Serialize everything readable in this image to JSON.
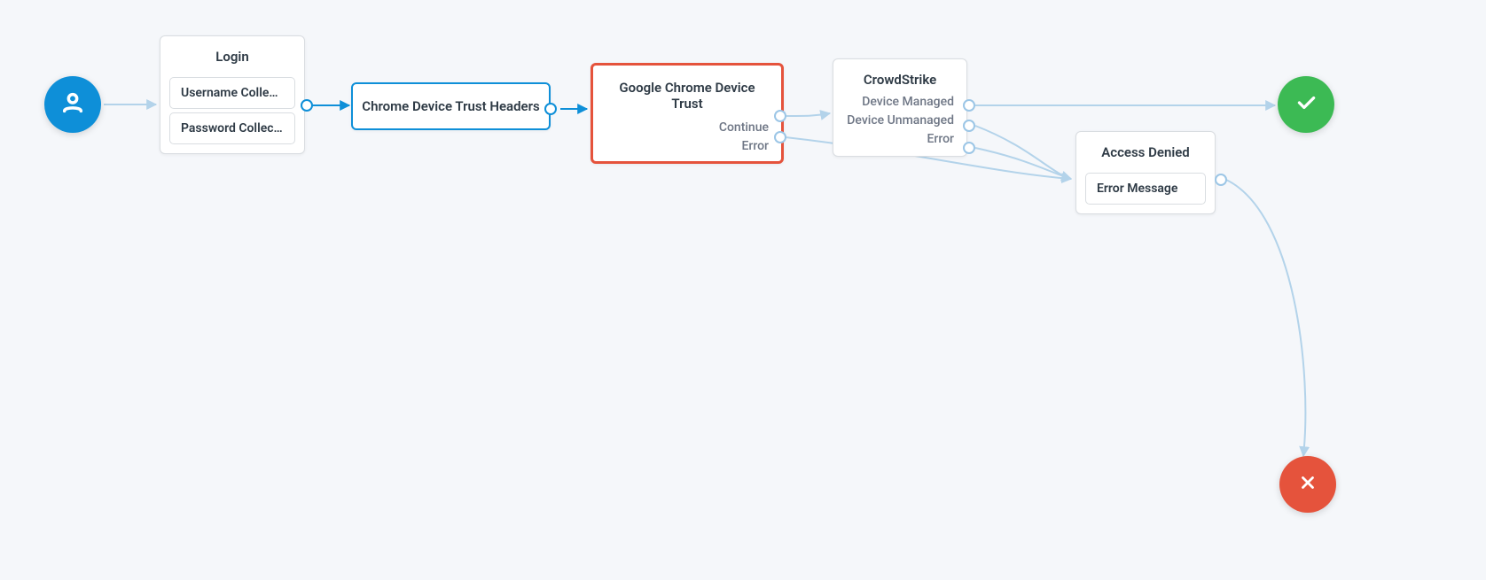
{
  "colors": {
    "start": "#0e8fd8",
    "success": "#3cba54",
    "fail": "#e5533c",
    "selected": "#e5533c",
    "node_border": "#d9dde1",
    "canvas_bg": "#f5f7fa"
  },
  "nodes": {
    "login": {
      "title": "Login",
      "items": [
        "Username Colle…",
        "Password Collec…"
      ]
    },
    "chrome_headers": {
      "title": "Chrome Device Trust Headers"
    },
    "chrome_trust": {
      "title": "Google Chrome Device Trust",
      "outputs": [
        "Continue",
        "Error"
      ],
      "selected": true
    },
    "crowdstrike": {
      "title": "CrowdStrike",
      "outputs": [
        "Device Managed",
        "Device Unmanaged",
        "Error"
      ]
    },
    "access_denied": {
      "title": "Access Denied",
      "items": [
        "Error Message"
      ]
    }
  },
  "terminals": {
    "start": "user",
    "success": "check",
    "fail": "x"
  }
}
